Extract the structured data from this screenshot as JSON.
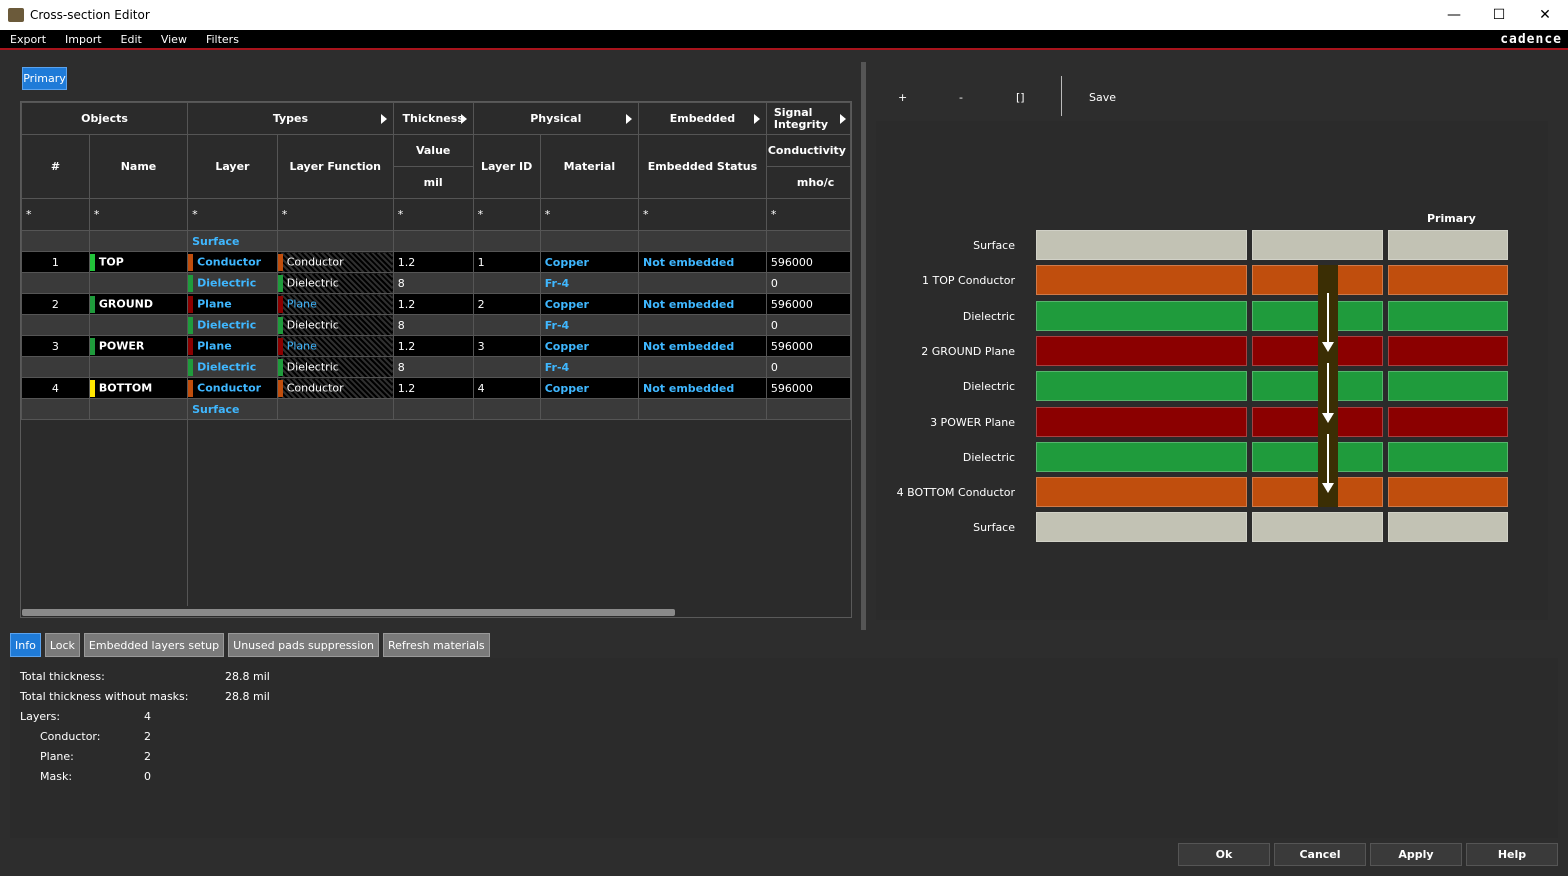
{
  "window": {
    "title": "Cross-section Editor",
    "minimize": "—",
    "maximize": "☐",
    "close": "✕"
  },
  "menu": [
    "Export",
    "Import",
    "Edit",
    "View",
    "Filters"
  ],
  "brand": "cadence",
  "tab": "Primary",
  "table": {
    "groups": [
      "Objects",
      "Types",
      "Thickness",
      "Physical",
      "Embedded",
      "Signal Integrity"
    ],
    "cols": [
      "#",
      "Name",
      "Layer",
      "Layer Function",
      "Value",
      "mil",
      "Layer ID",
      "Material",
      "Embedded Status",
      "Conductivity",
      "mho/c"
    ],
    "filter": "*",
    "rows": [
      {
        "num": "",
        "name": "",
        "layer": "Surface",
        "func": "",
        "value": "",
        "lid": "",
        "material": "",
        "emb": "",
        "cond": ""
      },
      {
        "num": "1",
        "name": "TOP",
        "layer": "Conductor",
        "func": "Conductor",
        "value": "1.2",
        "lid": "1",
        "material": "Copper",
        "emb": "Not embedded",
        "cond": "596000"
      },
      {
        "num": "",
        "name": "",
        "layer": "Dielectric",
        "func": "Dielectric",
        "value": "8",
        "lid": "",
        "material": "Fr-4",
        "emb": "",
        "cond": "0"
      },
      {
        "num": "2",
        "name": "GROUND",
        "layer": "Plane",
        "func": "Plane",
        "value": "1.2",
        "lid": "2",
        "material": "Copper",
        "emb": "Not embedded",
        "cond": "596000"
      },
      {
        "num": "",
        "name": "",
        "layer": "Dielectric",
        "func": "Dielectric",
        "value": "8",
        "lid": "",
        "material": "Fr-4",
        "emb": "",
        "cond": "0"
      },
      {
        "num": "3",
        "name": "POWER",
        "layer": "Plane",
        "func": "Plane",
        "value": "1.2",
        "lid": "3",
        "material": "Copper",
        "emb": "Not embedded",
        "cond": "596000"
      },
      {
        "num": "",
        "name": "",
        "layer": "Dielectric",
        "func": "Dielectric",
        "value": "8",
        "lid": "",
        "material": "Fr-4",
        "emb": "",
        "cond": "0"
      },
      {
        "num": "4",
        "name": "BOTTOM",
        "layer": "Conductor",
        "func": "Conductor",
        "value": "1.2",
        "lid": "4",
        "material": "Copper",
        "emb": "Not embedded",
        "cond": "596000"
      },
      {
        "num": "",
        "name": "",
        "layer": "Surface",
        "func": "",
        "value": "",
        "lid": "",
        "material": "",
        "emb": "",
        "cond": ""
      }
    ]
  },
  "toolbar": {
    "plus": "+",
    "minus": "-",
    "bracket": "[]",
    "save": "Save"
  },
  "xsection": {
    "primary_label": "Primary",
    "labels": [
      "Surface",
      "1   TOP Conductor",
      "Dielectric",
      "2   GROUND Plane",
      "Dielectric",
      "3   POWER Plane",
      "Dielectric",
      "4   BOTTOM Conductor",
      "Surface"
    ],
    "colors": {
      "surface": "#c2c2b4",
      "conductor": "#c04e0d",
      "dielectric": "#1f9b3c",
      "plane": "#8b0000",
      "via": "#3b2e04"
    }
  },
  "bottom_tabs": [
    "Info",
    "Lock",
    "Embedded layers setup",
    "Unused pads suppression",
    "Refresh materials"
  ],
  "info": {
    "total_thickness_label": "Total thickness:",
    "total_thickness": "28.8 mil",
    "no_masks_label": "Total thickness without masks:",
    "no_masks": "28.8 mil",
    "layers_label": "Layers:",
    "layers": "4",
    "conductor_label": "Conductor:",
    "conductor": "2",
    "plane_label": "Plane:",
    "plane": "2",
    "mask_label": "Mask:",
    "mask": "0"
  },
  "buttons": {
    "ok": "Ok",
    "cancel": "Cancel",
    "apply": "Apply",
    "help": "Help"
  }
}
